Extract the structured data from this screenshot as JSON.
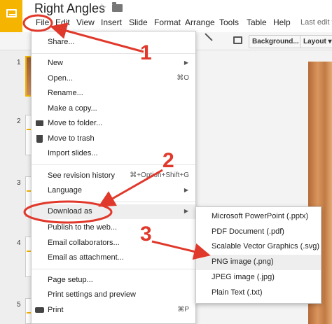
{
  "header": {
    "title": "Right Angles",
    "status": "Last edit w"
  },
  "menubar": [
    "File",
    "Edit",
    "View",
    "Insert",
    "Slide",
    "Format",
    "Arrange",
    "Tools",
    "Table",
    "Help"
  ],
  "toolbar": {
    "background_label": "Background...",
    "layout_label": "Layout"
  },
  "filmstrip": {
    "slide_numbers": [
      "1",
      "2",
      "3",
      "4",
      "5"
    ]
  },
  "file_menu": {
    "share": "Share...",
    "new": "New",
    "open": "Open...",
    "open_shortcut": "⌘O",
    "rename": "Rename...",
    "make_copy": "Make a copy...",
    "move_to_folder": "Move to folder...",
    "move_to_trash": "Move to trash",
    "import_slides": "Import slides...",
    "revision_history": "See revision history",
    "revision_shortcut": "⌘+Option+Shift+G",
    "language": "Language",
    "download_as": "Download as",
    "publish": "Publish to the web...",
    "email_collaborators": "Email collaborators...",
    "email_attachment": "Email as attachment...",
    "page_setup": "Page setup...",
    "print_settings": "Print settings and preview",
    "print": "Print",
    "print_shortcut": "⌘P"
  },
  "download_submenu": {
    "pptx": "Microsoft PowerPoint (.pptx)",
    "pdf": "PDF Document (.pdf)",
    "svg": "Scalable Vector Graphics (.svg)",
    "png": "PNG image (.png)",
    "jpeg": "JPEG image (.jpg)",
    "txt": "Plain Text (.txt)"
  },
  "annotations": {
    "step1": "1",
    "step2": "2",
    "step3": "3",
    "color": "#e0392b"
  }
}
